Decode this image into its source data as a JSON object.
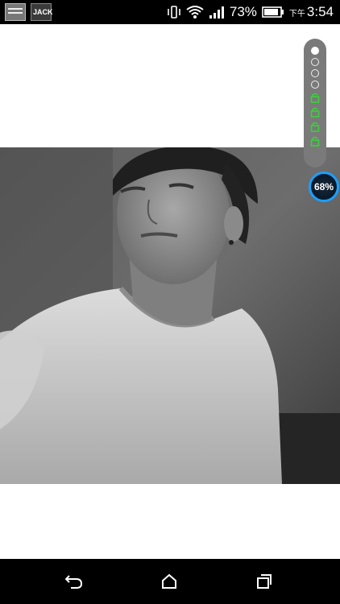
{
  "status_bar": {
    "notifications": [
      {
        "icon": "image-notification-icon"
      },
      {
        "icon": "app-notification-icon",
        "label": "JACK"
      }
    ],
    "battery_percent": "73%",
    "time_prefix": "下午",
    "time": "3:54"
  },
  "floating_tool": {
    "indicators": [
      "filled",
      "empty",
      "empty",
      "empty"
    ],
    "locks": [
      "lock-icon",
      "lock-icon",
      "lock-icon",
      "lock-icon"
    ],
    "boost_value": "68%",
    "colors": {
      "lock": "#3ad13a",
      "boost_ring": "#1aa0ff"
    }
  },
  "photo": {
    "subject": "portrait-photo"
  },
  "nav_bar": {
    "buttons": [
      "back",
      "home",
      "recents"
    ]
  }
}
